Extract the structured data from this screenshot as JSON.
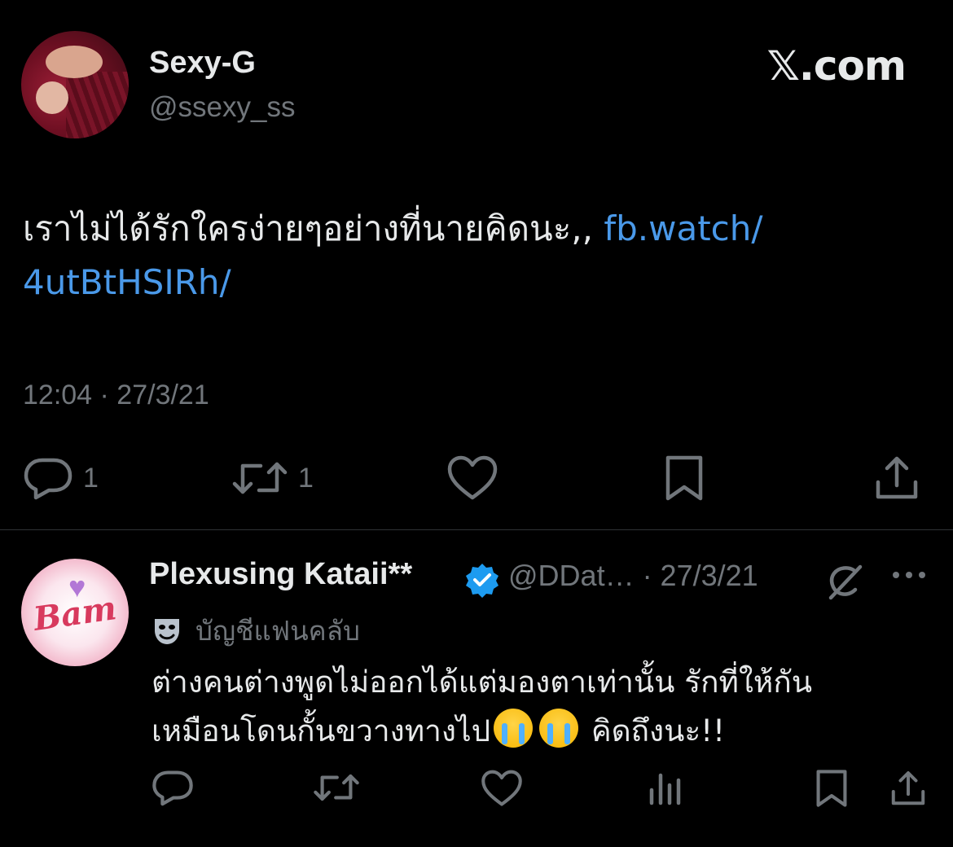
{
  "main_tweet": {
    "display_name": "Sexy-G",
    "handle": "@ssexy_ss",
    "site_label": "𝕏.com",
    "text": "เราไม่ได้รักใครง่ายๆอย่างที่นายคิดนะ,, ",
    "link": "fb.watch/​4utBtHSIRh/",
    "timestamp": "12:04 · 27/3/21",
    "actions": {
      "reply_count": "1",
      "repost_count": "1"
    }
  },
  "reply_tweet": {
    "display_name": "Plexusing Kataii**",
    "handle_date": "@DDat… · 27/3/21",
    "badge_label": "บัญชีแฟนคลับ",
    "text_line1": "ต่างคนต่างพูดไม่ออกได้แต่มองตาเท่านั้น รักที่ให้กัน",
    "text_line2_a": "เหมือนโดนกั้นขวางทางไป",
    "text_line2_b": " คิดถึงนะ!!",
    "avatar_text": "Bam"
  },
  "colors": {
    "background": "#000000",
    "text": "#e7e9ea",
    "muted": "#71767b",
    "link": "#4a99e9",
    "verified": "#1d9bf0",
    "divider": "#2f3336"
  },
  "icons": [
    "reply-icon",
    "repost-icon",
    "like-icon",
    "bookmark-icon",
    "share-icon",
    "views-icon",
    "verified-icon",
    "grok-icon",
    "more-icon",
    "theater-mask-icon",
    "loudly-crying-face-emoji"
  ]
}
